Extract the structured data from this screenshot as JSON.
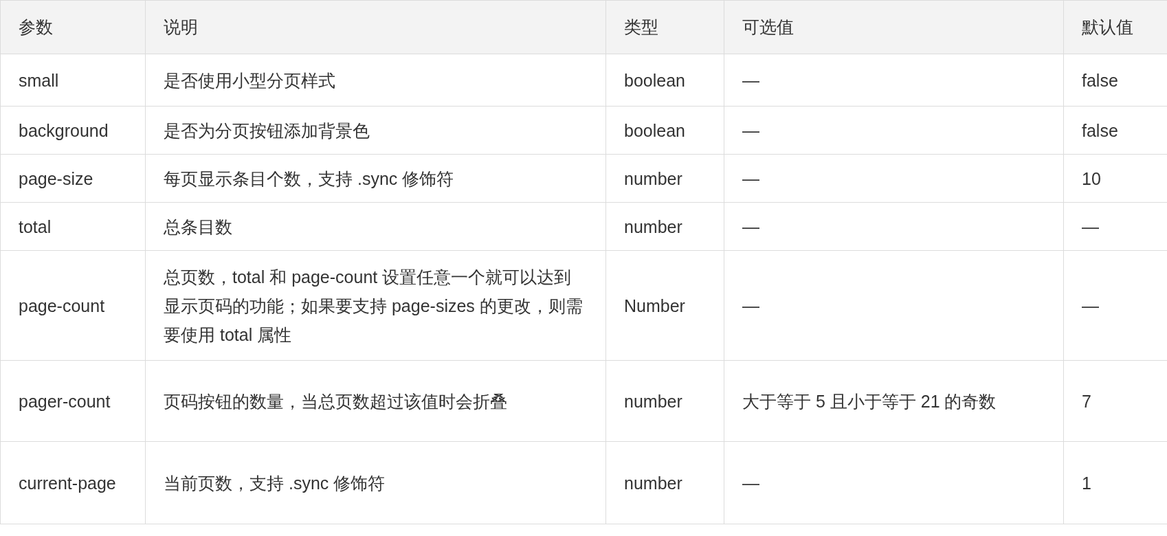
{
  "table": {
    "columns": [
      "参数",
      "说明",
      "类型",
      "可选值",
      "默认值"
    ],
    "rows": [
      [
        "small",
        "是否使用小型分页样式",
        "boolean",
        "—",
        "false"
      ],
      [
        "background",
        "是否为分页按钮添加背景色",
        "boolean",
        "—",
        "false"
      ],
      [
        "page-size",
        "每页显示条目个数，支持 .sync 修饰符",
        "number",
        "—",
        "10"
      ],
      [
        "total",
        "总条目数",
        "number",
        "—",
        "—"
      ],
      [
        "page-count",
        "总页数，total 和 page-count 设置任意一个就可以达到显示页码的功能；如果要支持 page-sizes 的更改，则需要使用 total 属性",
        "Number",
        "—",
        "—"
      ],
      [
        "pager-count",
        "页码按钮的数量，当总页数超过该值时会折叠",
        "number",
        "大于等于 5 且小于等于 21 的奇数",
        "7"
      ],
      [
        "current-page",
        "当前页数，支持 .sync 修饰符",
        "number",
        "—",
        "1"
      ]
    ]
  }
}
